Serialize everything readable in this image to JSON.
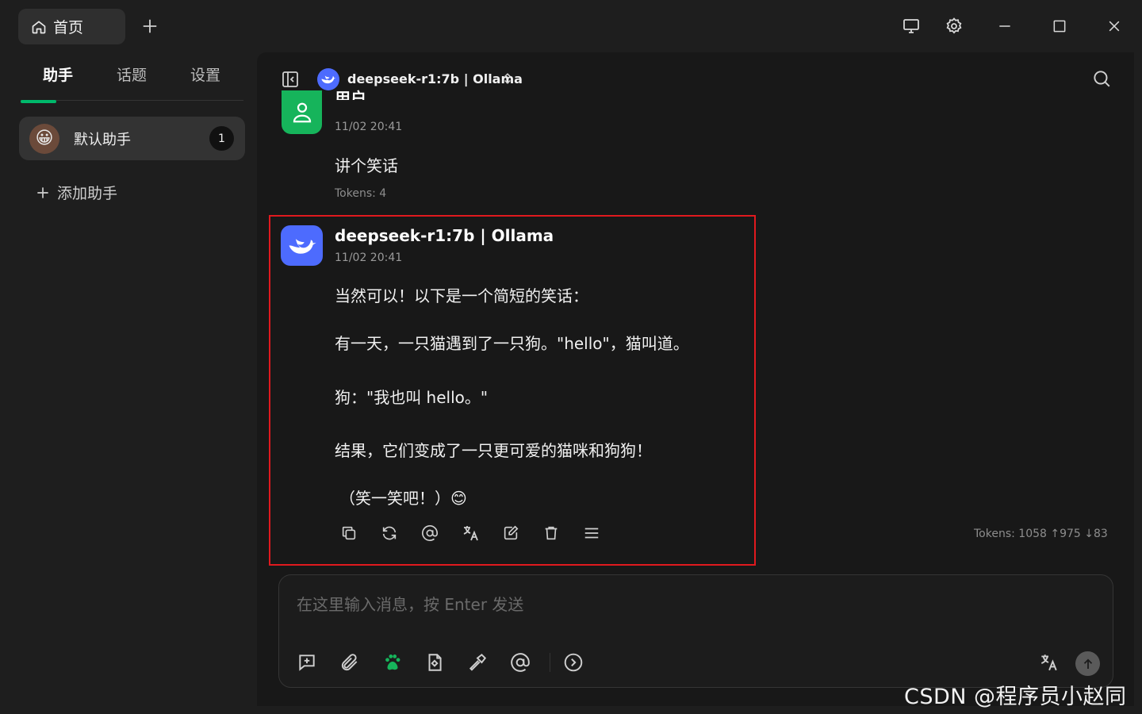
{
  "titlebar": {
    "home_tab_label": "首页"
  },
  "sidebar": {
    "tabs": [
      {
        "label": "助手",
        "active": true
      },
      {
        "label": "话题",
        "active": false
      },
      {
        "label": "设置",
        "active": false
      }
    ],
    "assistant": {
      "name": "默认助手",
      "topic_count": "1",
      "avatar": "😀"
    },
    "add_assistant_label": "添加助手"
  },
  "header": {
    "model_label": "deepseek-r1:7b | Ollama"
  },
  "messages": {
    "user": {
      "name": "用户",
      "timestamp": "11/02 20:41",
      "text": "讲个笑话",
      "tokens": "Tokens: 4"
    },
    "assistant": {
      "name": "deepseek-r1:7b | Ollama",
      "timestamp": "11/02 20:41",
      "lines": [
        "当然可以！以下是一个简短的笑话：",
        "有一天，一只猫遇到了一只狗。\"hello\"，猫叫道。",
        "狗：\"我也叫 hello。\"",
        "结果，它们变成了一只更可爱的猫咪和狗狗！",
        "（笑一笑吧！）😊"
      ],
      "tokens": "Tokens: 1058 ↑975 ↓83"
    }
  },
  "input": {
    "placeholder": "在这里输入消息，按 Enter 发送"
  },
  "watermark": "CSDN @程序员小赵同学",
  "colors": {
    "accent_green": "#00b96b",
    "user_avatar": "#16b45b",
    "deepseek_blue": "#4d6bfe",
    "highlight_red": "#e0191e"
  }
}
